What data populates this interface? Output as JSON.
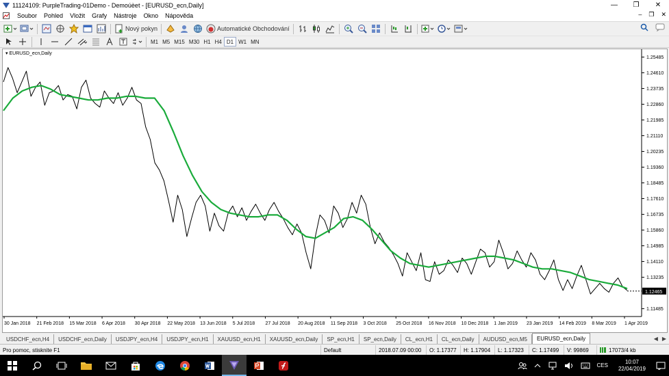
{
  "window": {
    "title": "11124109: PurpleTrading-01Demo - Demoúèet - [EURUSD_ecn,Daily]",
    "minimize": "—",
    "restore": "❐",
    "close": "✕"
  },
  "menu": {
    "items": [
      "Soubor",
      "Pohled",
      "Vložit",
      "Grafy",
      "Nástroje",
      "Okno",
      "Nápověda"
    ],
    "mdi_minimize": "–",
    "mdi_restore": "❐",
    "mdi_close": "✕"
  },
  "toolbar": {
    "new_order": "Nový pokyn",
    "auto_trading": "Automatické Obchodování"
  },
  "timeframes": [
    "M1",
    "M5",
    "M15",
    "M30",
    "H1",
    "H4",
    "D1",
    "W1",
    "MN"
  ],
  "active_timeframe": "D1",
  "chart": {
    "label": "EURUSD_ecn,Daily",
    "price_labels": [
      "1.25485",
      "1.24610",
      "1.23735",
      "1.22860",
      "1.21985",
      "1.21110",
      "1.20235",
      "1.19360",
      "1.18485",
      "1.17610",
      "1.16735",
      "1.15860",
      "1.14985",
      "1.14110",
      "1.13235",
      "1.11485"
    ],
    "current_price": "1.12465",
    "date_labels": [
      "30 Jan 2018",
      "21 Feb 2018",
      "15 Mar 2018",
      "6 Apr 2018",
      "30 Apr 2018",
      "22 May 2018",
      "13 Jun 2018",
      "5 Jul 2018",
      "27 Jul 2018",
      "20 Aug 2018",
      "11 Sep 2018",
      "3 Oct 2018",
      "25 Oct 2018",
      "16 Nov 2018",
      "10 Dec 2018",
      "1 Jan 2019",
      "23 Jan 2019",
      "14 Feb 2019",
      "8 Mar 2019",
      "1 Apr 2019"
    ],
    "colors": {
      "price_line": "#000000",
      "ma_line": "#1aab3b",
      "background": "#ffffff",
      "price_tag_bg": "#000000"
    }
  },
  "chart_data": {
    "type": "line",
    "symbol": "EURUSD_ecn",
    "timeframe": "Daily",
    "ylim": [
      1.1105,
      1.2592
    ],
    "y_ticks": [
      1.25485,
      1.2461,
      1.23735,
      1.2286,
      1.21985,
      1.2111,
      1.20235,
      1.1936,
      1.18485,
      1.1761,
      1.16735,
      1.1586,
      1.14985,
      1.1411,
      1.13235,
      1.11485
    ],
    "x_ticks": [
      "30 Jan 2018",
      "21 Feb 2018",
      "15 Mar 2018",
      "6 Apr 2018",
      "30 Apr 2018",
      "22 May 2018",
      "13 Jun 2018",
      "5 Jul 2018",
      "27 Jul 2018",
      "20 Aug 2018",
      "11 Sep 2018",
      "3 Oct 2018",
      "25 Oct 2018",
      "16 Nov 2018",
      "10 Dec 2018",
      "1 Jan 2019",
      "23 Jan 2019",
      "14 Feb 2019",
      "8 Mar 2019",
      "1 Apr 2019"
    ],
    "grid": false,
    "current_price": 1.12465,
    "series": [
      {
        "values": [
          1.241,
          1.249,
          1.243,
          1.235,
          1.241,
          1.247,
          1.233,
          1.238,
          1.241,
          1.228,
          1.235,
          1.236,
          1.239,
          1.231,
          1.234,
          1.233,
          1.226,
          1.238,
          1.242,
          1.232,
          1.229,
          1.227,
          1.236,
          1.232,
          1.229,
          1.235,
          1.228,
          1.232,
          1.238,
          1.231,
          1.229,
          1.216,
          1.209,
          1.196,
          1.192,
          1.186,
          1.175,
          1.163,
          1.178,
          1.17,
          1.155,
          1.165,
          1.174,
          1.178,
          1.172,
          1.158,
          1.168,
          1.161,
          1.158,
          1.168,
          1.172,
          1.166,
          1.171,
          1.164,
          1.169,
          1.173,
          1.168,
          1.164,
          1.17,
          1.174,
          1.169,
          1.165,
          1.16,
          1.156,
          1.162,
          1.157,
          1.146,
          1.137,
          1.155,
          1.167,
          1.164,
          1.157,
          1.172,
          1.168,
          1.16,
          1.165,
          1.174,
          1.168,
          1.178,
          1.173,
          1.16,
          1.151,
          1.157,
          1.152,
          1.149,
          1.145,
          1.14,
          1.133,
          1.146,
          1.141,
          1.136,
          1.146,
          1.131,
          1.13,
          1.141,
          1.134,
          1.136,
          1.142,
          1.139,
          1.135,
          1.143,
          1.14,
          1.134,
          1.141,
          1.148,
          1.146,
          1.138,
          1.141,
          1.153,
          1.146,
          1.137,
          1.14,
          1.147,
          1.142,
          1.138,
          1.146,
          1.142,
          1.134,
          1.131,
          1.136,
          1.142,
          1.131,
          1.125,
          1.131,
          1.126,
          1.133,
          1.139,
          1.131,
          1.123,
          1.126,
          1.129,
          1.126,
          1.124,
          1.129,
          1.132,
          1.127,
          1.125
        ]
      },
      {
        "values": [
          1.225,
          1.232,
          1.236,
          1.238,
          1.239,
          1.237,
          1.234,
          1.233,
          1.232,
          1.231,
          1.231,
          1.232,
          1.232,
          1.233,
          1.233,
          1.232,
          1.232,
          1.225,
          1.213,
          1.2,
          1.189,
          1.18,
          1.174,
          1.17,
          1.168,
          1.167,
          1.166,
          1.166,
          1.167,
          1.167,
          1.164,
          1.159,
          1.155,
          1.154,
          1.157,
          1.16,
          1.165,
          1.166,
          1.164,
          1.159,
          1.153,
          1.147,
          1.143,
          1.14,
          1.139,
          1.138,
          1.139,
          1.14,
          1.141,
          1.142,
          1.143,
          1.144,
          1.144,
          1.143,
          1.142,
          1.14,
          1.138,
          1.137,
          1.137,
          1.136,
          1.135,
          1.133,
          1.131,
          1.13,
          1.129,
          1.128,
          1.126
        ]
      }
    ]
  },
  "tabs": [
    "USDCHF_ecn,H4",
    "USDCHF_ecn,Daily",
    "USDJPY_ecn,H4",
    "USDJPY_ecn,H1",
    "XAUUSD_ecn,H1",
    "XAUUSD_ecn,Daily",
    "SP_ecn,H1",
    "SP_ecn,Daily",
    "CL_ecn,H1",
    "CL_ecn,Daily",
    "AUDUSD_ecn,M5",
    "EURUSD_ecn,Daily"
  ],
  "active_tab": "EURUSD_ecn,Daily",
  "status": {
    "help": "Pro pomoc, stisknite F1",
    "profile": "Default",
    "datetime": "2018.07.09 00:00",
    "open": "O: 1.17377",
    "high": "H: 1.17904",
    "low": "L: 1.17323",
    "close": "C: 1.17499",
    "volume": "V: 99869",
    "traffic": "17073/4 kb"
  },
  "taskbar": {
    "lang": "CES",
    "time": "10:07",
    "date": "22/04/2019"
  }
}
